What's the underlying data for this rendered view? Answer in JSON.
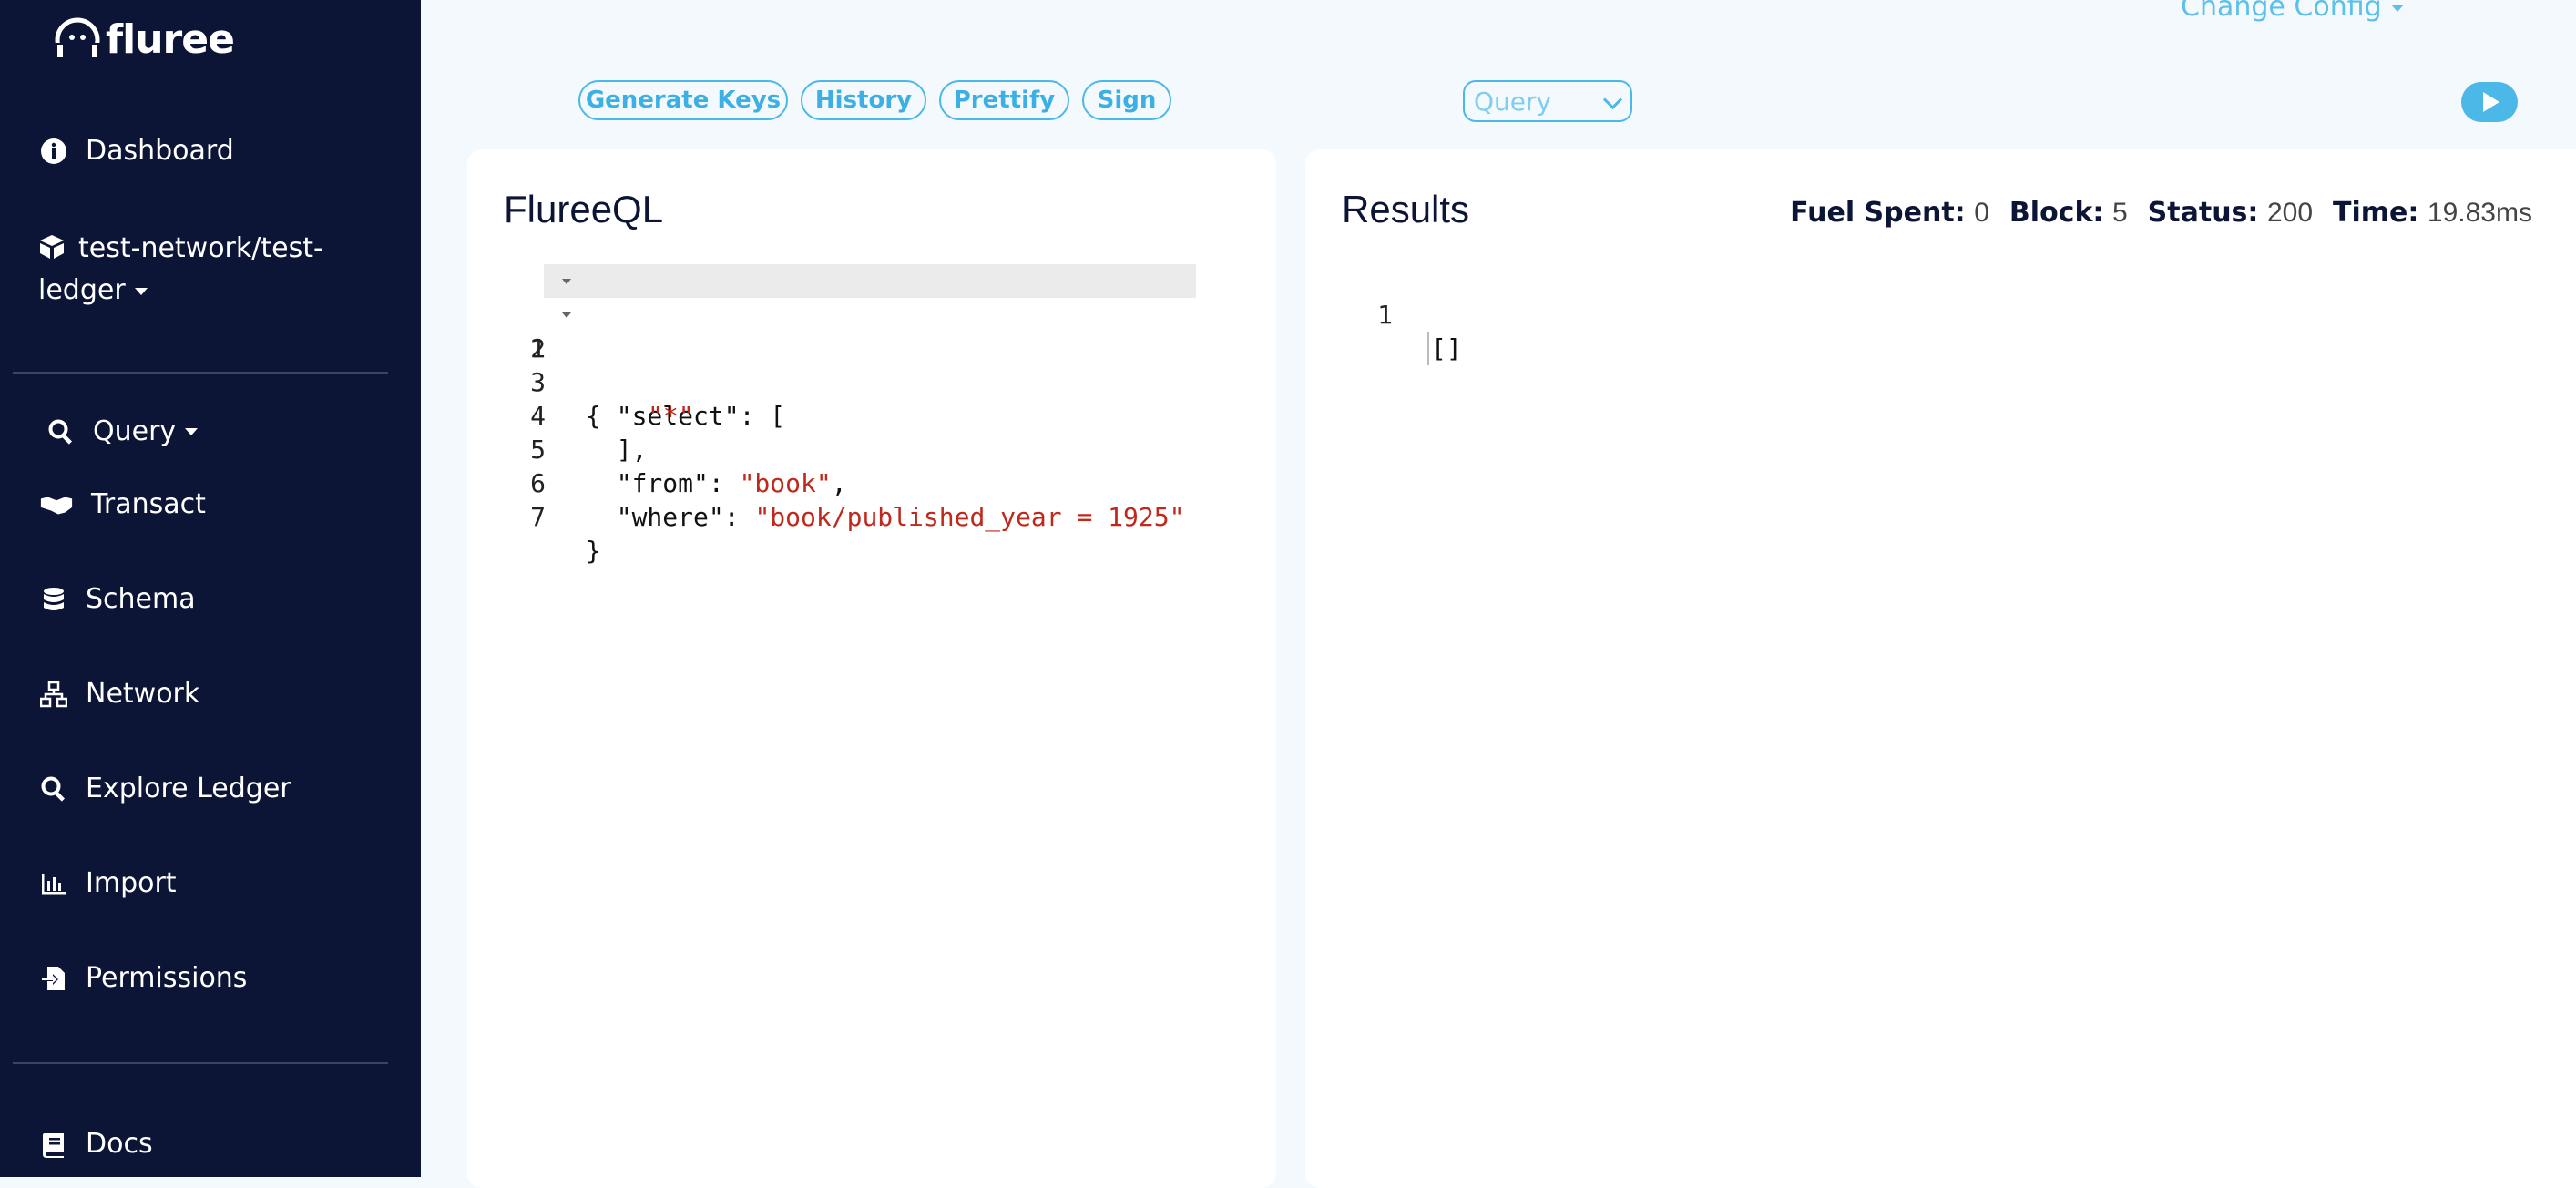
{
  "brand": {
    "name": "fluree"
  },
  "sidebar": {
    "dashboard": "Dashboard",
    "ledger": "test-network/test-ledger",
    "query": "Query",
    "transact": "Transact",
    "schema": "Schema",
    "network": "Network",
    "explore": "Explore Ledger",
    "import": "Import",
    "permissions": "Permissions",
    "docs": "Docs"
  },
  "topbar": {
    "change_config": "Change Config",
    "buttons": [
      "Generate Keys",
      "History",
      "Prettify",
      "Sign"
    ],
    "query_type": "Query"
  },
  "editor": {
    "title": "FlureeQL",
    "lines": [
      "1",
      "2",
      "3",
      "4",
      "5",
      "6",
      "7"
    ],
    "code": {
      "l1": "{",
      "l2": "  \"select\": [",
      "l3_str": "\"*\"",
      "l4": "  ],",
      "l5_key": "  \"from\": ",
      "l5_str": "\"book\"",
      "l5_tail": ",",
      "l6_key": "  \"where\": ",
      "l6_str": "\"book/published_year = 1925\"",
      "l7": "}"
    }
  },
  "results": {
    "title": "Results",
    "fuel_label": "Fuel Spent:",
    "fuel_value": "0",
    "block_label": "Block:",
    "block_value": "5",
    "status_label": "Status:",
    "status_value": "200",
    "time_label": "Time:",
    "time_value": "19.83ms",
    "line_no": "1",
    "output": "[]"
  },
  "colors": {
    "sidebar": "#0c1535",
    "accent": "#4cb8e8",
    "string": "#c0281c",
    "background": "#f3f9fc"
  }
}
